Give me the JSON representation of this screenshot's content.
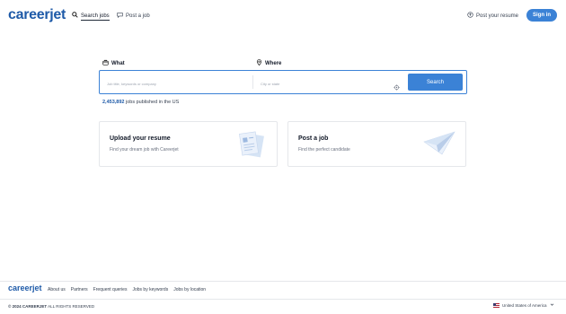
{
  "header": {
    "logo": "careerjet",
    "nav": [
      {
        "label": "Search jobs",
        "icon": "search-icon"
      },
      {
        "label": "Post a job",
        "icon": "chat-icon"
      }
    ],
    "post_resume": "Post your resume",
    "signin": "Sign in"
  },
  "search": {
    "what_label": "What",
    "where_label": "Where",
    "what_placeholder": "Job title, keywords or company",
    "where_placeholder": "City or state",
    "button": "Search"
  },
  "stats": {
    "count": "2,453,892",
    "text": "jobs published in the US"
  },
  "cards": [
    {
      "title": "Upload your resume",
      "desc": "Find your dream job with Careerjet"
    },
    {
      "title": "Post a job",
      "desc": "Find the perfect candidate"
    }
  ],
  "footer": {
    "logo": "careerjet",
    "links": [
      "About us",
      "Partners",
      "Frequent queries",
      "Jobs by keywords",
      "Jobs by location"
    ],
    "copyright_bold": "© 2024 CAREERJET",
    "copyright_rest": "ALL RIGHTS RESERVED",
    "region": "United States of America"
  },
  "colors": {
    "brand": "#1e5aa8",
    "accent": "#3b82d6"
  }
}
